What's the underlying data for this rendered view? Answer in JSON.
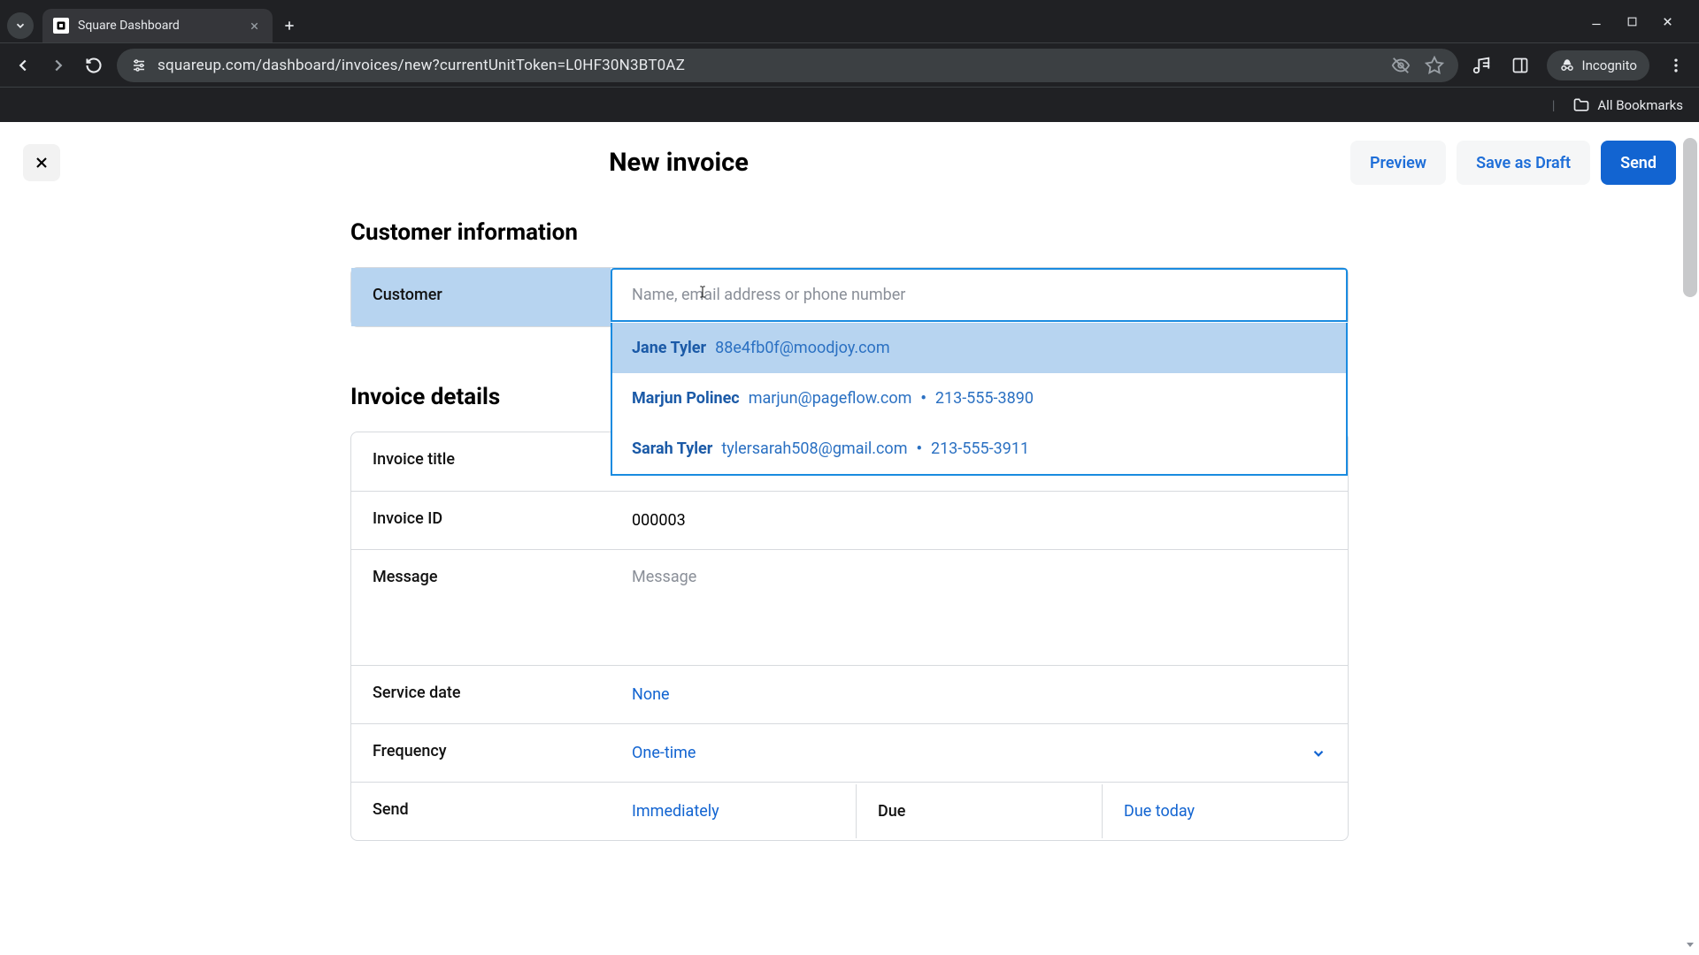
{
  "browser": {
    "tab_title": "Square Dashboard",
    "url": "squareup.com/dashboard/invoices/new?currentUnitToken=L0HF30N3BT0AZ",
    "incognito_label": "Incognito",
    "all_bookmarks_label": "All Bookmarks"
  },
  "header": {
    "title": "New invoice",
    "preview_label": "Preview",
    "save_draft_label": "Save as Draft",
    "send_label": "Send"
  },
  "customer_section": {
    "heading": "Customer information",
    "customer_label": "Customer",
    "placeholder": "Name, email address or phone number",
    "suggestions": [
      {
        "name": "Jane Tyler",
        "email": "88e4fb0f@moodjoy.com",
        "phone": ""
      },
      {
        "name": "Marjun Polinec",
        "email": "marjun@pageflow.com",
        "phone": "213-555-3890"
      },
      {
        "name": "Sarah Tyler",
        "email": "tylersarah508@gmail.com",
        "phone": "213-555-3911"
      }
    ]
  },
  "invoice_section": {
    "heading": "Invoice details",
    "title_label": "Invoice title",
    "title_value": "",
    "id_label": "Invoice ID",
    "id_value": "000003",
    "message_label": "Message",
    "message_placeholder": "Message",
    "service_date_label": "Service date",
    "service_date_value": "None",
    "frequency_label": "Frequency",
    "frequency_value": "One-time",
    "send_label": "Send",
    "send_value": "Immediately",
    "due_label": "Due",
    "due_value": "Due today"
  }
}
